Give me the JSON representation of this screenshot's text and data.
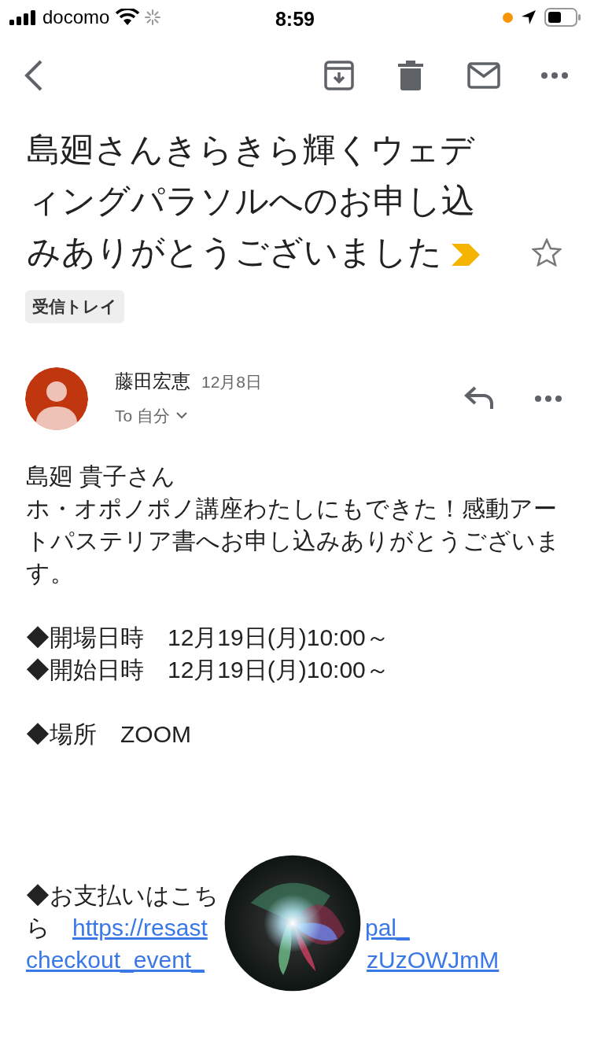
{
  "status_bar": {
    "carrier": "docomo",
    "time": "8:59"
  },
  "subject": {
    "text": "島廻さんきらきら輝くウェディングパラソルへのお申し込みありがとうございました",
    "important": true,
    "starred": false
  },
  "labels": [
    "受信トレイ"
  ],
  "message": {
    "sender": "藤田宏恵",
    "date": "12月8日",
    "recipient": "To 自分"
  },
  "body": {
    "paragraphs": [
      [
        "島廻 貴子さん",
        "ホ・オポノポノ講座わたしにもできた！感動アートパステリア書へお申し込みありがとうございます。"
      ],
      [
        "◆開場日時　12月19日(月)10:00～",
        "◆開始日時　12月19日(月)10:00～"
      ],
      [
        "◆場所　ZOOM"
      ]
    ],
    "payment": {
      "label": "◆お支払いはこち",
      "label_end": "ら",
      "link_lines": [
        [
          "https://resast",
          "pal_"
        ],
        [
          "checkout_event_",
          "zUzOWJmM"
        ]
      ]
    }
  }
}
